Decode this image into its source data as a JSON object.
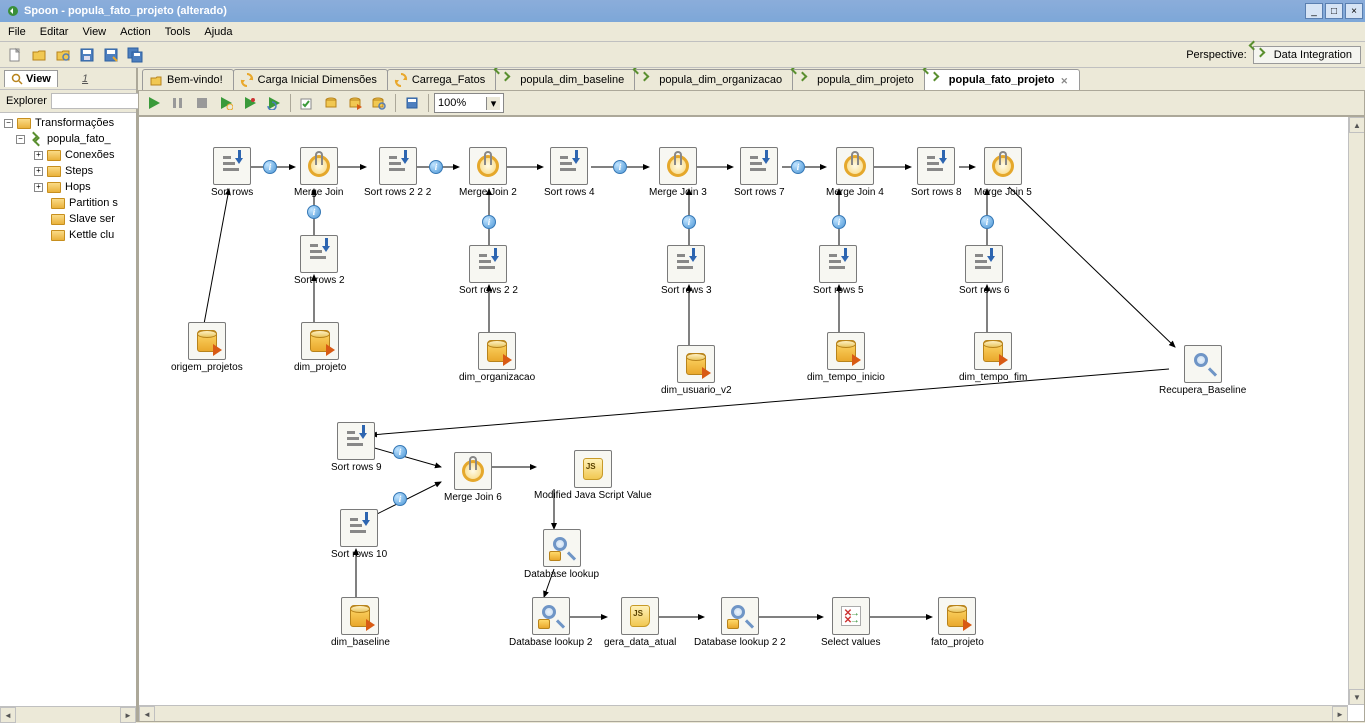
{
  "window": {
    "title": "Spoon - popula_fato_projeto (alterado)"
  },
  "menubar": {
    "items": [
      "File",
      "Editar",
      "View",
      "Action",
      "Tools",
      "Ajuda"
    ]
  },
  "perspective": {
    "label": "Perspective:",
    "button": "Data Integration"
  },
  "sidebar": {
    "view_tab": "View",
    "designNum": "1",
    "explorer": "Explorer",
    "tree": {
      "root": "Transformações",
      "item1": "popula_fato_",
      "item2": "Conexões",
      "item3": "Steps",
      "item4": "Hops",
      "item5": "Partition s",
      "item6": "Slave ser",
      "item7": "Kettle clu"
    }
  },
  "tabs": {
    "t0": "Bem-vindo!",
    "t1": "Carga Inicial Dimensões",
    "t2": "Carrega_Fatos",
    "t3": "popula_dim_baseline",
    "t4": "popula_dim_organizacao",
    "t5": "popula_dim_projeto",
    "t6": "popula_fato_projeto"
  },
  "zoom": "100%",
  "nodes": {
    "sort1": "Sort rows",
    "mj1": "Merge Join",
    "sort222": "Sort rows 2 2 2",
    "mj2": "Merge Join 2",
    "sort4": "Sort rows 4",
    "mj3": "Merge Join 3",
    "sort7": "Sort rows 7",
    "mj4": "Merge Join 4",
    "sort8": "Sort rows 8",
    "mj5": "Merge Join 5",
    "sort2": "Sort rows 2",
    "sort22": "Sort rows 2 2",
    "sort3": "Sort rows 3",
    "sort5": "Sort rows 5",
    "sort6": "Sort rows 6",
    "origem": "origem_projetos",
    "dimproj": "dim_projeto",
    "dimorg": "dim_organizacao",
    "dimusr": "dim_usuario_v2",
    "dimti": "dim_tempo_inicio",
    "dimtf": "dim_tempo_fim",
    "recbase": "Recupera_Baseline",
    "sort9": "Sort rows 9",
    "mj6": "Merge Join 6",
    "mjs": "Modified Java Script Value",
    "sort10": "Sort rows 10",
    "dbl": "Database lookup",
    "dimbase": "dim_baseline",
    "dbl2": "Database lookup 2",
    "gera": "gera_data_atual",
    "dbl22": "Database lookup 2 2",
    "selv": "Select values",
    "fato": "fato_projeto"
  }
}
